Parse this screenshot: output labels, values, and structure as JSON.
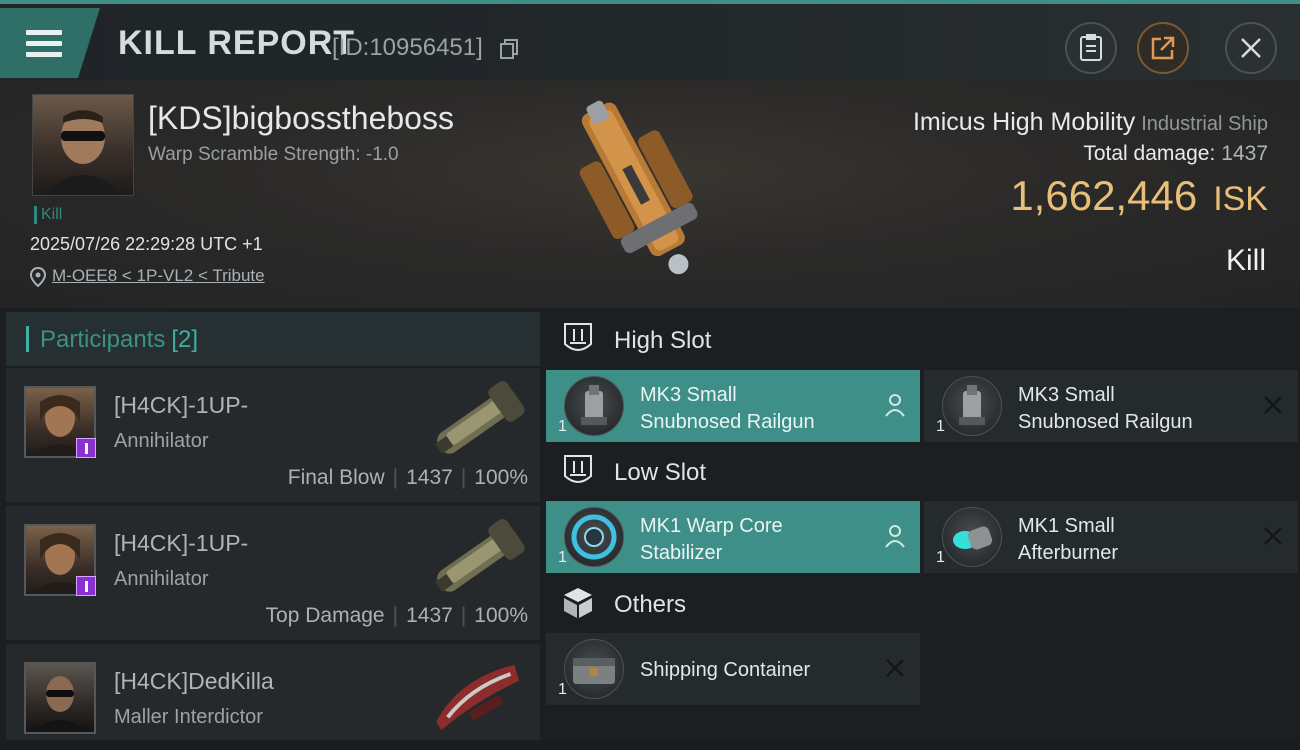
{
  "header": {
    "title": "KILL REPORT",
    "report_id": "[ID:10956451]",
    "icons": [
      "menu-icon",
      "copy-icon",
      "clipboard-icon",
      "share-icon",
      "close-icon"
    ]
  },
  "victim": {
    "name": "[KDS]bigbosstheboss",
    "warp_scramble": "Warp Scramble Strength: -1.0",
    "kill_tag": "Kill",
    "timestamp": "2025/07/26 22:29:28 UTC +1",
    "location": "M-OEE8 < 1P-VL2 < Tribute",
    "ship_name": "Imicus High Mobility",
    "ship_class": "Industrial Ship",
    "total_damage_label": "Total damage:",
    "total_damage": "1437",
    "isk_value": "1,662,446",
    "isk_unit": "ISK",
    "result": "Kill"
  },
  "participants": {
    "label": "Participants",
    "count": "[2]",
    "rows": [
      {
        "name": "[H4CK]-1UP-",
        "ship": "Annihilator",
        "role": "Final Blow",
        "damage": "1437",
        "percent": "100%"
      },
      {
        "name": "[H4CK]-1UP-",
        "ship": "Annihilator",
        "role": "Top Damage",
        "damage": "1437",
        "percent": "100%"
      },
      {
        "name": "[H4CK]DedKilla",
        "ship": "Maller Interdictor",
        "role": "",
        "damage": "",
        "percent": ""
      }
    ]
  },
  "slots": {
    "high": {
      "label": "High Slot",
      "modules": [
        {
          "qty": "1",
          "line1": "MK3 Small",
          "line2": "Snubnosed Railgun",
          "state": "dropped-active"
        },
        {
          "qty": "1",
          "line1": "MK3 Small",
          "line2": "Snubnosed Railgun",
          "state": "destroyed"
        }
      ]
    },
    "low": {
      "label": "Low Slot",
      "modules": [
        {
          "qty": "1",
          "line1": "MK1 Warp Core",
          "line2": "Stabilizer",
          "state": "dropped-active"
        },
        {
          "qty": "1",
          "line1": "MK1 Small",
          "line2": "Afterburner",
          "state": "destroyed"
        }
      ]
    },
    "others": {
      "label": "Others",
      "modules": [
        {
          "qty": "1",
          "line1": "Shipping Container",
          "line2": "",
          "state": "destroyed"
        }
      ]
    }
  },
  "colors": {
    "accent": "#3e8f87",
    "isk": "#e9be76",
    "badge_purple": "#8a2fd1"
  }
}
